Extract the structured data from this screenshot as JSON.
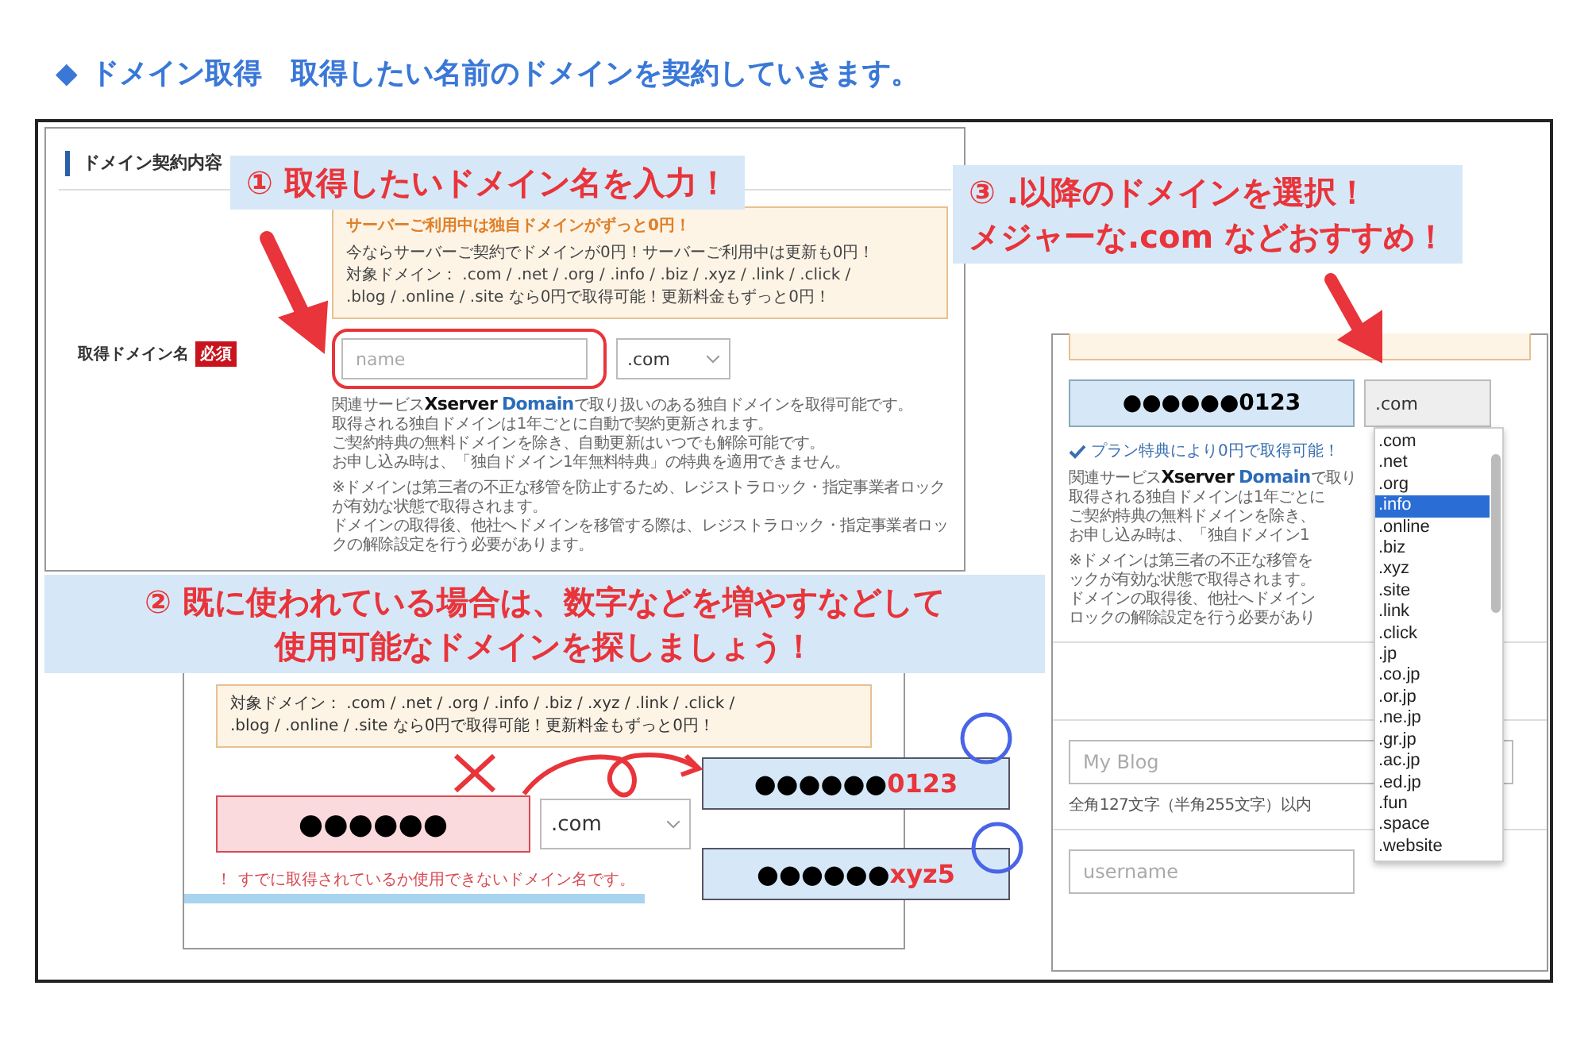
{
  "heading": {
    "marker": "◆",
    "text": "ドメイン取得　取得したい名前のドメインを契約していきます。"
  },
  "callouts": [
    {
      "lines": [
        "① 取得したいドメイン名を入力！"
      ]
    },
    {
      "lines": [
        "② 既に使われている場合は、数字などを増やすなどして",
        "使用可能なドメインを探しましょう！"
      ]
    },
    {
      "lines": [
        "③ .以降のドメインを選択！",
        "メジャーな.com などおすすめ！"
      ]
    }
  ],
  "form_panel": {
    "section_title": "ドメイン契約内容",
    "notice": {
      "title": "サーバーご利用中は独自ドメインがずっと0円！",
      "lines": [
        "今ならサーバーご契約でドメインが0円！サーバーご利用中は更新も0円！",
        "対象ドメイン： .com / .net / .org / .info / .biz / .xyz / .link / .click /",
        ".blog / .online / .site なら0円で取得可能！更新料金もずっと0円！"
      ]
    },
    "field_label": "取得ドメイン名",
    "required_badge": "必須",
    "domain_input": {
      "placeholder": "name"
    },
    "tld_select": {
      "value": ".com"
    },
    "service_prefix": "関連サービス",
    "brand_1": "Xserver",
    "brand_2": "Domain",
    "service_suffix": "で取り扱いのある独自ドメインを取得可能です。",
    "description": [
      "取得される独自ドメインは1年ごとに自動で契約更新されます。",
      "ご契約特典の無料ドメインを除き、自動更新はいつでも解除可能です。",
      "お申し込み時は、「独自ドメイン1年無料特典」の特典を適用できません。"
    ],
    "note": [
      "※ドメインは第三者の不正な移管を防止するため、レジストラロック・指定事業者ロックが有効な状態で取得されます。",
      "ドメインの取得後、他社へドメインを移管する際は、レジストラロック・指定事業者ロックの解除設定を行う必要があります。"
    ]
  },
  "error_panel": {
    "notice_lines": [
      "対象ドメイン： .com / .net / .org / .info / .biz / .xyz / .link / .click /",
      ".blog / .online / .site なら0円で取得可能！更新料金もずっと0円！"
    ],
    "domain_input": {
      "value": "●●●●●●"
    },
    "tld_select": {
      "value": ".com"
    },
    "error_mark": "！",
    "error_message": "すでに取得されているか使用できないドメイン名です。"
  },
  "suggestions": [
    {
      "base": "●●●●●●",
      "suffix": "0123"
    },
    {
      "base": "●●●●●●",
      "suffix": "xyz5"
    }
  ],
  "select_panel": {
    "domain_input": {
      "value": "●●●●●●0123"
    },
    "tld_select": {
      "value": ".com"
    },
    "ok_message": "プラン特典により0円で取得可能！",
    "service_prefix": "関連サービス",
    "brand_1": "Xserver",
    "brand_2": "Domain",
    "service_suffix": "で取り",
    "description": [
      "取得される独自ドメインは1年ごとに",
      "ご契約特典の無料ドメインを除き、",
      "お申し込み時は、「独自ドメイン1"
    ],
    "note": [
      "※ドメインは第三者の不正な移管を",
      "ックが有効な状態で取得されます。",
      "ドメインの取得後、他社へドメイン",
      "ロックの解除設定を行う必要があり"
    ],
    "options": [
      {
        "label": ".com",
        "selected": false
      },
      {
        "label": ".net",
        "selected": false
      },
      {
        "label": ".org",
        "selected": false
      },
      {
        "label": ".info",
        "selected": true
      },
      {
        "label": ".online",
        "selected": false
      },
      {
        "label": ".biz",
        "selected": false
      },
      {
        "label": ".xyz",
        "selected": false
      },
      {
        "label": ".site",
        "selected": false
      },
      {
        "label": ".link",
        "selected": false
      },
      {
        "label": ".click",
        "selected": false
      },
      {
        "label": ".jp",
        "selected": false
      },
      {
        "label": ".co.jp",
        "selected": false
      },
      {
        "label": ".or.jp",
        "selected": false
      },
      {
        "label": ".ne.jp",
        "selected": false
      },
      {
        "label": ".gr.jp",
        "selected": false
      },
      {
        "label": ".ac.jp",
        "selected": false
      },
      {
        "label": ".ed.jp",
        "selected": false
      },
      {
        "label": ".fun",
        "selected": false
      },
      {
        "label": ".space",
        "selected": false
      },
      {
        "label": ".website",
        "selected": false
      }
    ],
    "title_input": {
      "placeholder": "My Blog"
    },
    "title_hint": "全角127文字（半角255文字）以内",
    "user_input": {
      "placeholder": "username"
    }
  }
}
